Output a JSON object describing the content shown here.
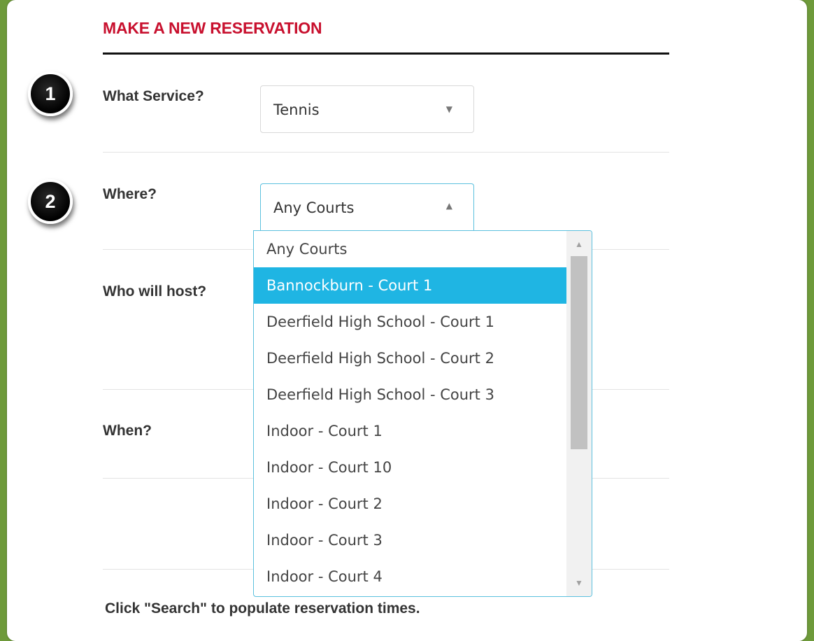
{
  "header": {
    "title": "MAKE A NEW RESERVATION"
  },
  "steps": {
    "step1": "1",
    "step2": "2"
  },
  "form": {
    "service_label": "What Service?",
    "service_value": "Tennis",
    "where_label": "Where?",
    "where_value": "Any Courts",
    "host_label": "Who will host?",
    "when_label": "When?"
  },
  "dropdown": {
    "options": [
      "Any Courts",
      "Bannockburn - Court 1",
      "Deerfield High School - Court 1",
      "Deerfield High School - Court 2",
      "Deerfield High School - Court 3",
      "Indoor - Court 1",
      "Indoor - Court 10",
      "Indoor - Court 2",
      "Indoor - Court 3",
      "Indoor - Court 4"
    ],
    "highlighted_index": 1
  },
  "footer": {
    "hint": "Click \"Search\" to populate reservation times."
  },
  "colors": {
    "frame": "#6e9a3a",
    "heading": "#c8102e",
    "highlight": "#1fb5e3",
    "focus_border": "#5bc0de"
  },
  "icons": {
    "select_arrow_closed": "caret-down-icon",
    "select_arrow_open": "caret-up-icon",
    "scroll_up": "scroll-up-arrow-icon",
    "scroll_down": "scroll-down-arrow-icon"
  }
}
